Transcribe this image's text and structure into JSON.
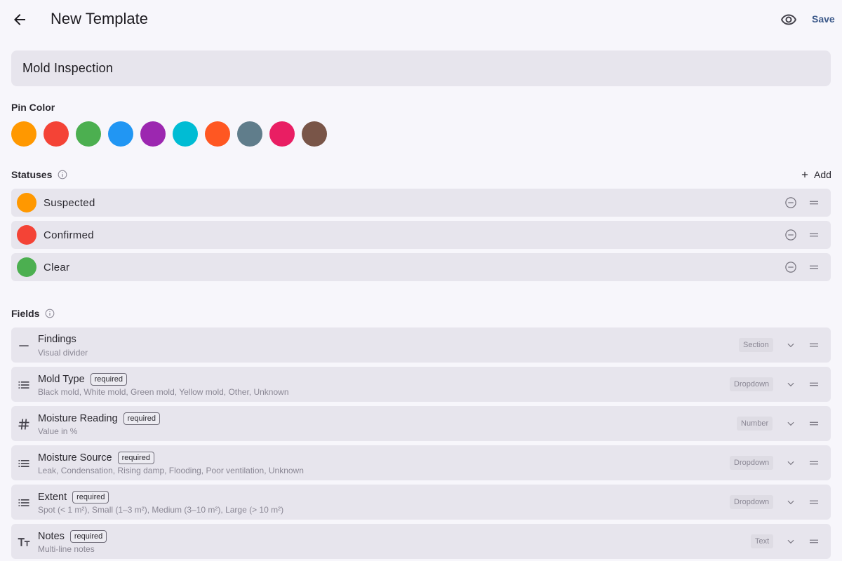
{
  "header": {
    "title": "New Template",
    "save_label": "Save"
  },
  "template_name": "Mold Inspection",
  "pin_color": {
    "label": "Pin Color",
    "colors": [
      "#ff9800",
      "#f44336",
      "#4caf50",
      "#2196f3",
      "#9c27b0",
      "#00bcd4",
      "#ff5722",
      "#607d8b",
      "#e91e63",
      "#795548"
    ]
  },
  "statuses": {
    "label": "Statuses",
    "add_label": "Add",
    "items": [
      {
        "name": "Suspected",
        "color": "#ff9800"
      },
      {
        "name": "Confirmed",
        "color": "#f44336"
      },
      {
        "name": "Clear",
        "color": "#4caf50"
      }
    ]
  },
  "fields": {
    "label": "Fields",
    "required_label": "required",
    "items": [
      {
        "name": "Findings",
        "description": "Visual divider",
        "type": "Section",
        "icon": "divider-icon",
        "required": false
      },
      {
        "name": "Mold Type",
        "description": "Black mold, White mold, Green mold, Yellow mold, Other, Unknown",
        "type": "Dropdown",
        "icon": "list-icon",
        "required": true
      },
      {
        "name": "Moisture Reading",
        "description": "Value in %",
        "type": "Number",
        "icon": "hash-icon",
        "required": true
      },
      {
        "name": "Moisture Source",
        "description": "Leak, Condensation, Rising damp, Flooding, Poor ventilation, Unknown",
        "type": "Dropdown",
        "icon": "list-icon",
        "required": true
      },
      {
        "name": "Extent",
        "description": "Spot (< 1 m²), Small (1–3 m²), Medium (3–10 m²), Large (> 10 m²)",
        "type": "Dropdown",
        "icon": "list-icon",
        "required": true
      },
      {
        "name": "Notes",
        "description": "Multi-line notes",
        "type": "Text",
        "icon": "text-format-icon",
        "required": true
      }
    ]
  }
}
